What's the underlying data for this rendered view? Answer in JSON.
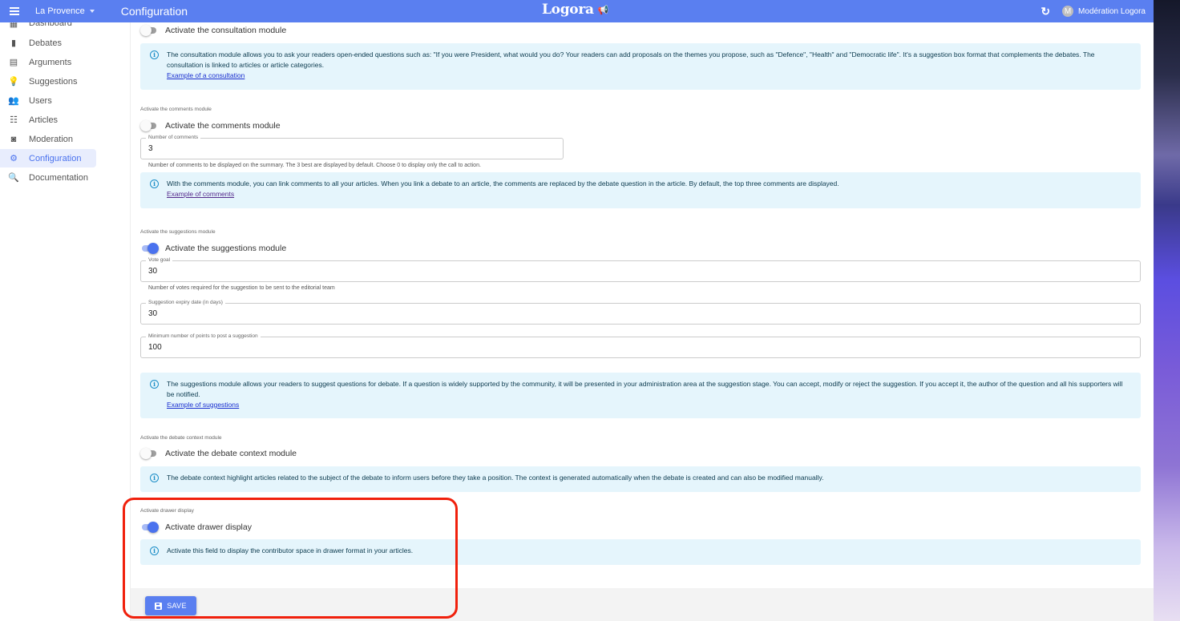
{
  "appbar": {
    "organization": "La Provence",
    "page_title": "Configuration",
    "logo_text": "Logora",
    "user_initial": "M",
    "user_name": "Modération Logora"
  },
  "sidebar": {
    "items": [
      {
        "label": "Dashboard",
        "icon": "dashboard-icon",
        "active": false
      },
      {
        "label": "Debates",
        "icon": "book-icon",
        "active": false
      },
      {
        "label": "Arguments",
        "icon": "comment-icon",
        "active": false
      },
      {
        "label": "Suggestions",
        "icon": "lightbulb-icon",
        "active": false
      },
      {
        "label": "Users",
        "icon": "people-icon",
        "active": false
      },
      {
        "label": "Articles",
        "icon": "post-add-icon",
        "active": false
      },
      {
        "label": "Moderation",
        "icon": "preview-icon",
        "active": false
      },
      {
        "label": "Configuration",
        "icon": "gear-icon",
        "active": true
      },
      {
        "label": "Documentation",
        "icon": "find-in-page-icon",
        "active": false
      }
    ]
  },
  "consultation": {
    "switch_label": "Activate the consultation module",
    "enabled": false,
    "info": "The consultation module allows you to ask your readers open-ended questions such as: \"If you were President, what would you do? Your readers can add proposals on the themes you propose, such as \"Defence\", \"Health\" and \"Democratic life\". It's a suggestion box format that complements the debates. The consultation is linked to articles or article categories.",
    "link": "Example of a consultation"
  },
  "comments": {
    "section_label": "Activate the comments module",
    "switch_label": "Activate the comments module",
    "enabled": false,
    "field_label": "Number of comments",
    "field_value": "3",
    "helper": "Number of comments to be displayed on the summary. The 3 best are displayed by default. Choose 0 to display only the call to action.",
    "info": "With the comments module, you can link comments to all your articles. When you link a debate to an article, the comments are replaced by the debate question in the article. By default, the top three comments are displayed.",
    "link": "Example of comments"
  },
  "suggestions": {
    "section_label": "Activate the suggestions module",
    "switch_label": "Activate the suggestions module",
    "enabled": true,
    "vote_goal_label": "Vote goal",
    "vote_goal_value": "30",
    "vote_goal_helper": "Number of votes required for the suggestion to be sent to the editorial team",
    "expiry_label": "Suggestion expiry date (in days)",
    "expiry_value": "30",
    "min_points_label": "Minimum number of points to post a suggestion",
    "min_points_value": "100",
    "info": "The suggestions module allows your readers to suggest questions for debate. If a question is widely supported by the community, it will be presented in your administration area at the suggestion stage. You can accept, modify or reject the suggestion. If you accept it, the author of the question and all his supporters will be notified.",
    "link": "Example of suggestions"
  },
  "debate_context": {
    "section_label": "Activate the debate context module",
    "switch_label": "Activate the debate context module",
    "enabled": false,
    "info": "The debate context highlight articles related to the subject of the debate to inform users before they take a position. The context is generated automatically when the debate is created and can also be modified manually."
  },
  "drawer": {
    "section_label": "Activate drawer display",
    "switch_label": "Activate drawer display",
    "enabled": true,
    "info": "Activate this field to display the contributor space in drawer format in your articles."
  },
  "footer": {
    "save_label": "SAVE"
  },
  "colors": {
    "primary": "#5a7ff0",
    "active_nav_bg": "#e8edfd",
    "info_bg": "#e5f5fc",
    "highlight": "#f0200c"
  }
}
